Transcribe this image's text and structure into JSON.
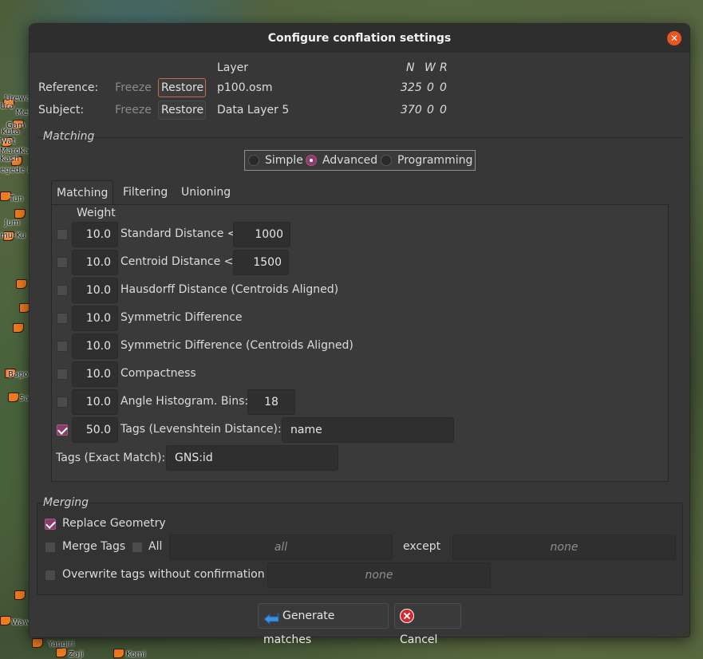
{
  "window": {
    "title": "Configure conflation settings"
  },
  "colors": {
    "accent": "#8a3c6a",
    "close": "#e95420",
    "map_pin": "#f07b1c"
  },
  "map": {
    "labels": [
      "Urewan",
      "Ura",
      "Mel",
      "Gam",
      "Kuta",
      "Wat",
      "Maro",
      "Kaso",
      "Kash",
      "egede Kp",
      "Tun",
      "Jum",
      "mu-Ku",
      "Bago",
      "Sa",
      "Waw",
      "Yangiri",
      "Zaji",
      "Komi"
    ]
  },
  "layers": {
    "header": {
      "layer": "Layer",
      "n": "N",
      "w": "W",
      "r": "R"
    },
    "reference": {
      "label": "Reference:",
      "freeze": "Freeze",
      "restore": "Restore",
      "layer": "p100.osm",
      "n": "325",
      "w": "0",
      "r": "0"
    },
    "subject": {
      "label": "Subject:",
      "freeze": "Freeze",
      "restore": "Restore",
      "layer": "Data Layer 5",
      "n": "370",
      "w": "0",
      "r": "0"
    }
  },
  "matching": {
    "title": "Matching",
    "modes": [
      "Simple",
      "Advanced",
      "Programming"
    ],
    "selected_mode": "Advanced",
    "tabs": [
      "Matching",
      "Filtering",
      "Unioning"
    ],
    "active_tab": "Matching",
    "weight_header": "Weight",
    "rows": [
      {
        "checked": false,
        "weight": "10.0",
        "label": "Standard Distance <",
        "value": "1000"
      },
      {
        "checked": false,
        "weight": "10.0",
        "label": "Centroid Distance <",
        "value": "1500"
      },
      {
        "checked": false,
        "weight": "10.0",
        "label": "Hausdorff Distance (Centroids Aligned)"
      },
      {
        "checked": false,
        "weight": "10.0",
        "label": "Symmetric Difference"
      },
      {
        "checked": false,
        "weight": "10.0",
        "label": "Symmetric Difference (Centroids Aligned)"
      },
      {
        "checked": false,
        "weight": "10.0",
        "label": "Compactness"
      },
      {
        "checked": false,
        "weight": "10.0",
        "label": "Angle Histogram. Bins:",
        "value": "18"
      },
      {
        "checked": true,
        "weight": "50.0",
        "label": "Tags (Levenshtein Distance):",
        "value": "name"
      }
    ],
    "exact_match": {
      "label": "Tags (Exact Match):",
      "value": "GNS:id"
    }
  },
  "merging": {
    "title": "Merging",
    "replace_geometry": {
      "label": "Replace Geometry",
      "checked": true
    },
    "merge_tags": {
      "label": "Merge Tags",
      "checked": false,
      "all_label": "All",
      "all_checked": false,
      "all_placeholder": "all",
      "except_label": "except",
      "except_placeholder": "none"
    },
    "overwrite": {
      "label": "Overwrite tags without confirmation",
      "checked": false,
      "placeholder": "none"
    }
  },
  "footer": {
    "generate": "Generate matches",
    "cancel": "Cancel"
  }
}
